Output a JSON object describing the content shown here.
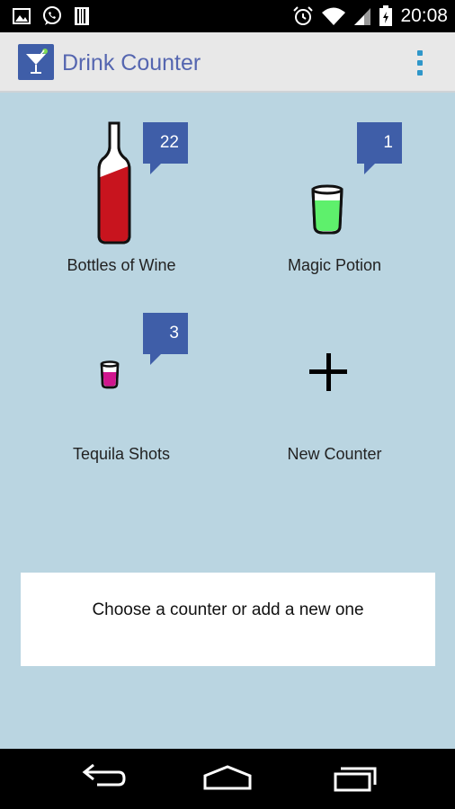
{
  "status_bar": {
    "time": "20:08",
    "left_icons": [
      "image-icon",
      "whatsapp-icon",
      "barcode-icon"
    ],
    "right_icons": [
      "alarm-icon",
      "wifi-icon",
      "signal-icon",
      "battery-icon"
    ]
  },
  "action_bar": {
    "title": "Drink Counter",
    "app_icon": "martini-glass-icon",
    "menu_icon": "overflow-menu-icon"
  },
  "counters": [
    {
      "label": "Bottles of Wine",
      "count": "22",
      "icon": "wine-bottle-icon",
      "color": "#c8141e"
    },
    {
      "label": "Magic Potion",
      "count": "1",
      "icon": "green-glass-icon",
      "color": "#5ef06c"
    },
    {
      "label": "Tequila Shots",
      "count": "3",
      "icon": "shot-glass-icon",
      "color": "#d0168e"
    },
    {
      "label": "New Counter",
      "icon": "plus-icon"
    }
  ],
  "info_text": "Choose a counter or add a new one",
  "nav_bar": {
    "buttons": [
      "back-icon",
      "home-icon",
      "recent-apps-icon"
    ]
  },
  "colors": {
    "accent": "#3f5ea8",
    "background": "#bad5e1",
    "action_bar": "#e8e8e8",
    "title": "#5566b0",
    "overflow": "#2f97c9"
  }
}
